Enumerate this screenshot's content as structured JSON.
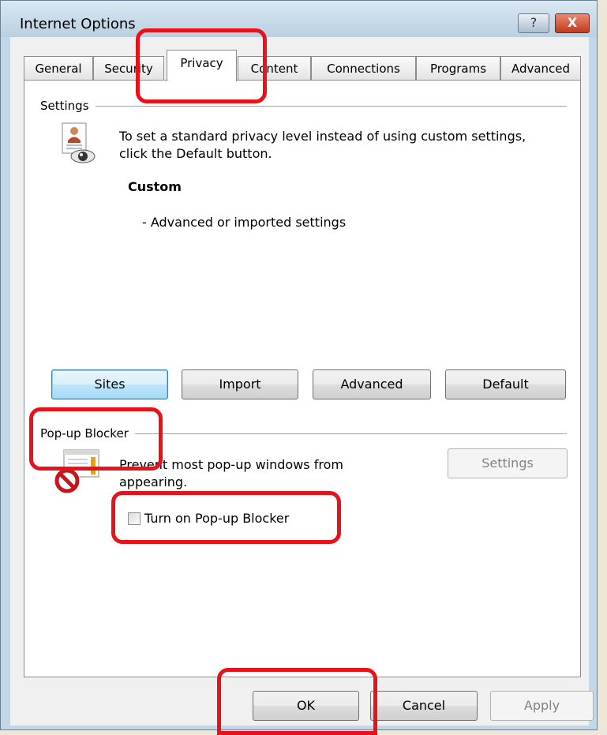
{
  "window": {
    "title": "Internet Options",
    "help_icon": "?",
    "close_icon": "X"
  },
  "tabs": [
    "General",
    "Security",
    "Privacy",
    "Content",
    "Connections",
    "Programs",
    "Advanced"
  ],
  "active_tab": "Privacy",
  "settings": {
    "group_label": "Settings",
    "icon": "privacy-settings-icon",
    "description": "To set a standard privacy level instead of using custom settings, click the Default button.",
    "level_name": "Custom",
    "level_detail": "- Advanced or imported settings",
    "buttons": {
      "sites": "Sites",
      "import": "Import",
      "advanced": "Advanced",
      "default": "Default"
    }
  },
  "popup_blocker": {
    "group_label": "Pop-up Blocker",
    "icon": "popup-blocker-icon",
    "description": "Prevent most pop-up windows from appearing.",
    "settings_button": "Settings",
    "checkbox_label": "Turn on Pop-up Blocker",
    "checkbox_checked": false
  },
  "footer": {
    "ok": "OK",
    "cancel": "Cancel",
    "apply": "Apply"
  },
  "colors": {
    "highlight": "#e8121a",
    "window_frame": "#c3d7e6",
    "focused_button": "#bee6fd"
  }
}
